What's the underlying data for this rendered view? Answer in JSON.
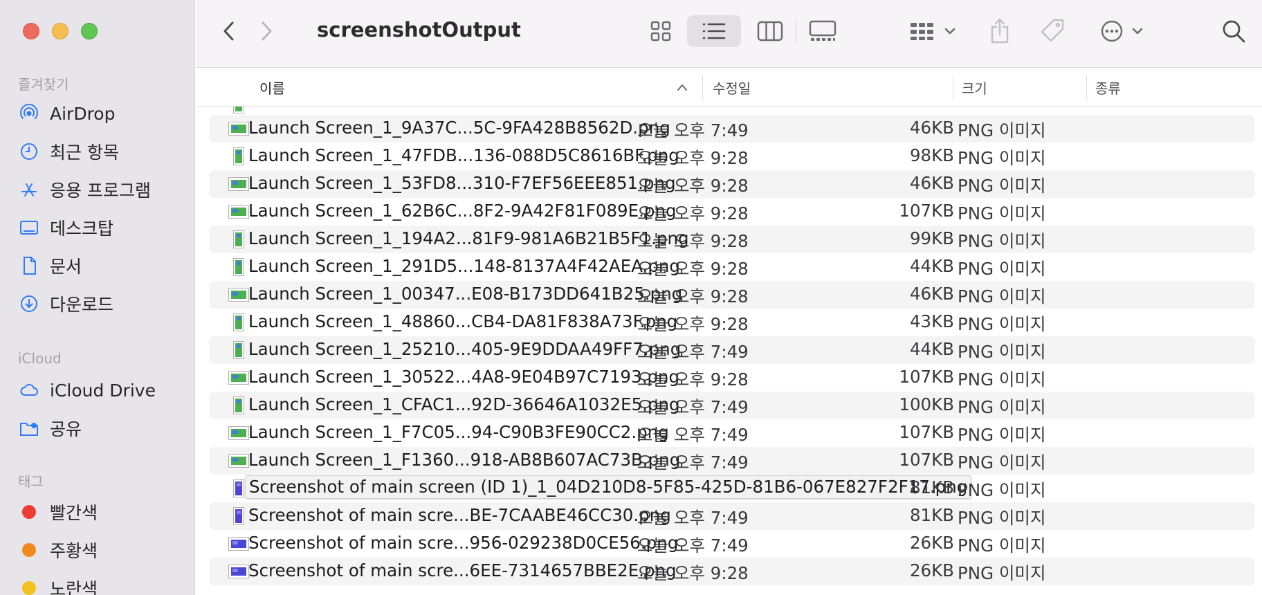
{
  "window": {
    "title": "screenshotOutput"
  },
  "sidebar": {
    "sections": {
      "favorites": "즐겨찾기",
      "icloud": "iCloud",
      "tags": "태그"
    },
    "favorites": [
      {
        "label": "AirDrop",
        "icon": "airdrop-icon"
      },
      {
        "label": "최근 항목",
        "icon": "clock-icon"
      },
      {
        "label": "응용 프로그램",
        "icon": "applications-icon"
      },
      {
        "label": "데스크탑",
        "icon": "desktop-icon"
      },
      {
        "label": "문서",
        "icon": "document-icon"
      },
      {
        "label": "다운로드",
        "icon": "download-icon"
      }
    ],
    "icloud": [
      {
        "label": "iCloud Drive",
        "icon": "cloud-icon"
      },
      {
        "label": "공유",
        "icon": "shared-folder-icon"
      }
    ],
    "tags": [
      {
        "label": "빨간색",
        "color": "#ee3b34"
      },
      {
        "label": "주황색",
        "color": "#f08a1e"
      },
      {
        "label": "노란색",
        "color": "#f4c21c"
      }
    ]
  },
  "toolbar": {
    "icons": [
      "back-icon",
      "forward-icon",
      "icon-view-icon",
      "list-view-icon",
      "column-view-icon",
      "gallery-view-icon",
      "group-icon",
      "share-icon",
      "tag-icon",
      "more-actions-icon",
      "search-icon"
    ],
    "active_view": "list"
  },
  "columns": {
    "name": "이름",
    "modified": "수정일",
    "size": "크기",
    "kind": "종류"
  },
  "files": [
    {
      "name": "Launch Screen_1_9A37C...5C-9FA428B8562D.png",
      "date": "오늘 오후 7:49",
      "size": "46KB",
      "kind": "PNG 이미지",
      "thumb": "landscape-green"
    },
    {
      "name": "Launch Screen_1_47FDB...136-088D5C8616BF.png",
      "date": "오늘 오후 9:28",
      "size": "98KB",
      "kind": "PNG 이미지",
      "thumb": "portrait-green"
    },
    {
      "name": "Launch Screen_1_53FD8...310-F7EF56EEE851.png",
      "date": "오늘 오후 9:28",
      "size": "46KB",
      "kind": "PNG 이미지",
      "thumb": "landscape-green"
    },
    {
      "name": "Launch Screen_1_62B6C...8F2-9A42F81F089E.png",
      "date": "오늘 오후 9:28",
      "size": "107KB",
      "kind": "PNG 이미지",
      "thumb": "landscape-green"
    },
    {
      "name": "Launch Screen_1_194A2...81F9-981A6B21B5F1.png",
      "date": "오늘 오후 9:28",
      "size": "99KB",
      "kind": "PNG 이미지",
      "thumb": "portrait-green"
    },
    {
      "name": "Launch Screen_1_291D5...148-8137A4F42AEA.png",
      "date": "오늘 오후 9:28",
      "size": "44KB",
      "kind": "PNG 이미지",
      "thumb": "portrait-green"
    },
    {
      "name": "Launch Screen_1_00347...E08-B173DD641B25.png",
      "date": "오늘 오후 9:28",
      "size": "46KB",
      "kind": "PNG 이미지",
      "thumb": "landscape-green"
    },
    {
      "name": "Launch Screen_1_48860...CB4-DA81F838A73F.png",
      "date": "오늘 오후 9:28",
      "size": "43KB",
      "kind": "PNG 이미지",
      "thumb": "portrait-green"
    },
    {
      "name": "Launch Screen_1_25210...405-9E9DDAA49FF7.png",
      "date": "오늘 오후 7:49",
      "size": "44KB",
      "kind": "PNG 이미지",
      "thumb": "portrait-green"
    },
    {
      "name": "Launch Screen_1_30522...4A8-9E04B97C7193.png",
      "date": "오늘 오후 9:28",
      "size": "107KB",
      "kind": "PNG 이미지",
      "thumb": "landscape-green"
    },
    {
      "name": "Launch Screen_1_CFAC1...92D-36646A1032E5.png",
      "date": "오늘 오후 7:49",
      "size": "100KB",
      "kind": "PNG 이미지",
      "thumb": "portrait-green"
    },
    {
      "name": "Launch Screen_1_F7C05...94-C90B3FE90CC2.png",
      "date": "오늘 오후 7:49",
      "size": "107KB",
      "kind": "PNG 이미지",
      "thumb": "landscape-green"
    },
    {
      "name": "Launch Screen_1_F1360...918-AB8B607AC73B.png",
      "date": "오늘 오후 7:49",
      "size": "107KB",
      "kind": "PNG 이미지",
      "thumb": "landscape-green"
    },
    {
      "name": "Screenshot of main screen (ID 1)_1_04D210D8-5F85-425D-81B6-067E827F2F17.png",
      "date": "",
      "size": "81KB",
      "kind": "PNG 이미지",
      "thumb": "portrait-blue",
      "tooltip": true
    },
    {
      "name": "Screenshot of main scre...BE-7CAABE46CC30.png",
      "date": "오늘 오후 7:49",
      "size": "81KB",
      "kind": "PNG 이미지",
      "thumb": "portrait-blue"
    },
    {
      "name": "Screenshot of main scre...956-029238D0CE56.png",
      "date": "오늘 오후 7:49",
      "size": "26KB",
      "kind": "PNG 이미지",
      "thumb": "landscape-blue"
    },
    {
      "name": "Screenshot of main scre...6EE-7314657BBE2E.png",
      "date": "오늘 오후 9:28",
      "size": "26KB",
      "kind": "PNG 이미지",
      "thumb": "landscape-blue"
    }
  ]
}
